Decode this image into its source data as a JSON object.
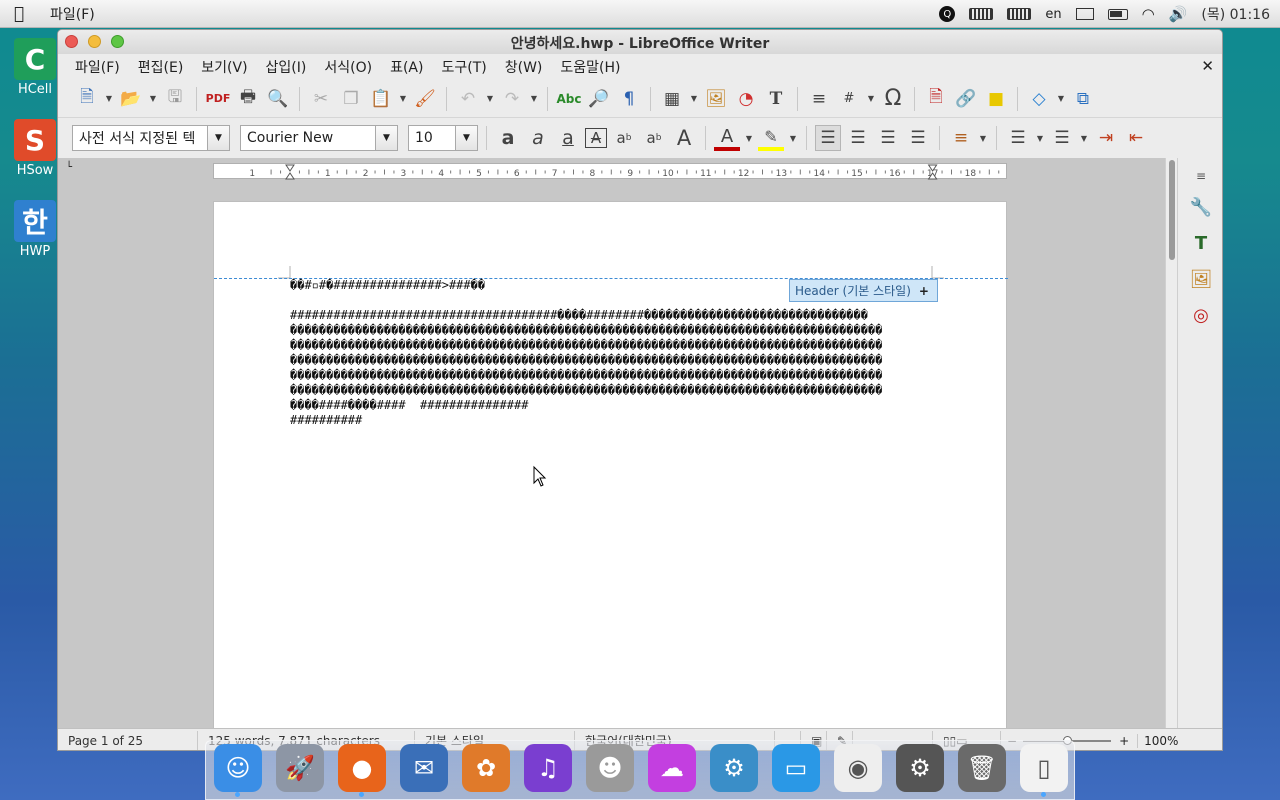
{
  "osbar": {
    "app_menu": "파일(F)",
    "search_icon": "Q",
    "lang": "en",
    "clock": "(목) 01:16"
  },
  "desktop_icons": [
    {
      "label": "HCell",
      "letter": "C",
      "color": "#1f9e5a"
    },
    {
      "label": "HSow",
      "letter": "S",
      "color": "#e04b2a"
    },
    {
      "label": "HWP",
      "letter": "한",
      "color": "#2f80cf"
    }
  ],
  "window": {
    "title": "안녕하세요.hwp - LibreOffice Writer"
  },
  "menu": [
    "파일(F)",
    "편집(E)",
    "보기(V)",
    "삽입(I)",
    "서식(O)",
    "표(A)",
    "도구(T)",
    "창(W)",
    "도움말(H)"
  ],
  "toolbar": {
    "style_value": "사전 서식 지정된 텍",
    "font_value": "Courier New",
    "size_value": "10"
  },
  "ruler": {
    "numbers": [
      "1",
      "1",
      "2",
      "3",
      "4",
      "5",
      "6",
      "7",
      "8",
      "9",
      "10",
      "11",
      "12",
      "13",
      "14",
      "15",
      "16",
      "17",
      "18"
    ]
  },
  "header_tag": {
    "label": "Header (기본 스타일)",
    "plus": "+"
  },
  "document": {
    "lines": [
      "��#▫#�###############>###��",
      "",
      "#####################################����########�������������������������������",
      "����������������������������������������������������������������������������������",
      "����������������������������������������������������������������������������������",
      "����������������������������������������������������������������������������������",
      "����������������������������������������������������������������������������������",
      "����������������������������������������������������������������������������������",
      "����####����####  ###############",
      "##########"
    ]
  },
  "status": {
    "page": "Page 1 of 25",
    "words": "125 words, 7,871 characters",
    "style": "기본 스타일",
    "lang": "한국어(대한민국)",
    "zoom": "100%",
    "zoom_minus": "−",
    "zoom_plus": "+"
  },
  "dock": [
    {
      "name": "finder",
      "glyph": "☺",
      "color": "#3a8ee6",
      "running": true
    },
    {
      "name": "launchpad",
      "glyph": "🚀",
      "color": "#8d96a5",
      "running": false
    },
    {
      "name": "firefox",
      "glyph": "●",
      "color": "#e8641b",
      "running": true
    },
    {
      "name": "thunderbird",
      "glyph": "✉",
      "color": "#3a6fb8",
      "running": false
    },
    {
      "name": "photo",
      "glyph": "✿",
      "color": "#e07a2a",
      "running": false
    },
    {
      "name": "itunes",
      "glyph": "♫",
      "color": "#7a3ed0",
      "running": false
    },
    {
      "name": "contacts",
      "glyph": "☻",
      "color": "#9a9a9a",
      "running": false
    },
    {
      "name": "icloud",
      "glyph": "☁",
      "color": "#c33fe0",
      "running": false
    },
    {
      "name": "appstore",
      "glyph": "⚙",
      "color": "#3a8ec8",
      "running": false
    },
    {
      "name": "remote-desktop",
      "glyph": "▭",
      "color": "#2a98e6",
      "running": false
    },
    {
      "name": "toggles",
      "glyph": "◉",
      "color": "#eeeeee",
      "running": false
    },
    {
      "name": "system-preferences",
      "glyph": "⚙",
      "color": "#555555",
      "running": false
    },
    {
      "name": "trash",
      "glyph": "🗑",
      "color": "#6a6a6a",
      "running": false
    },
    {
      "name": "document",
      "glyph": "▯",
      "color": "#f2f2f2",
      "running": true
    }
  ]
}
